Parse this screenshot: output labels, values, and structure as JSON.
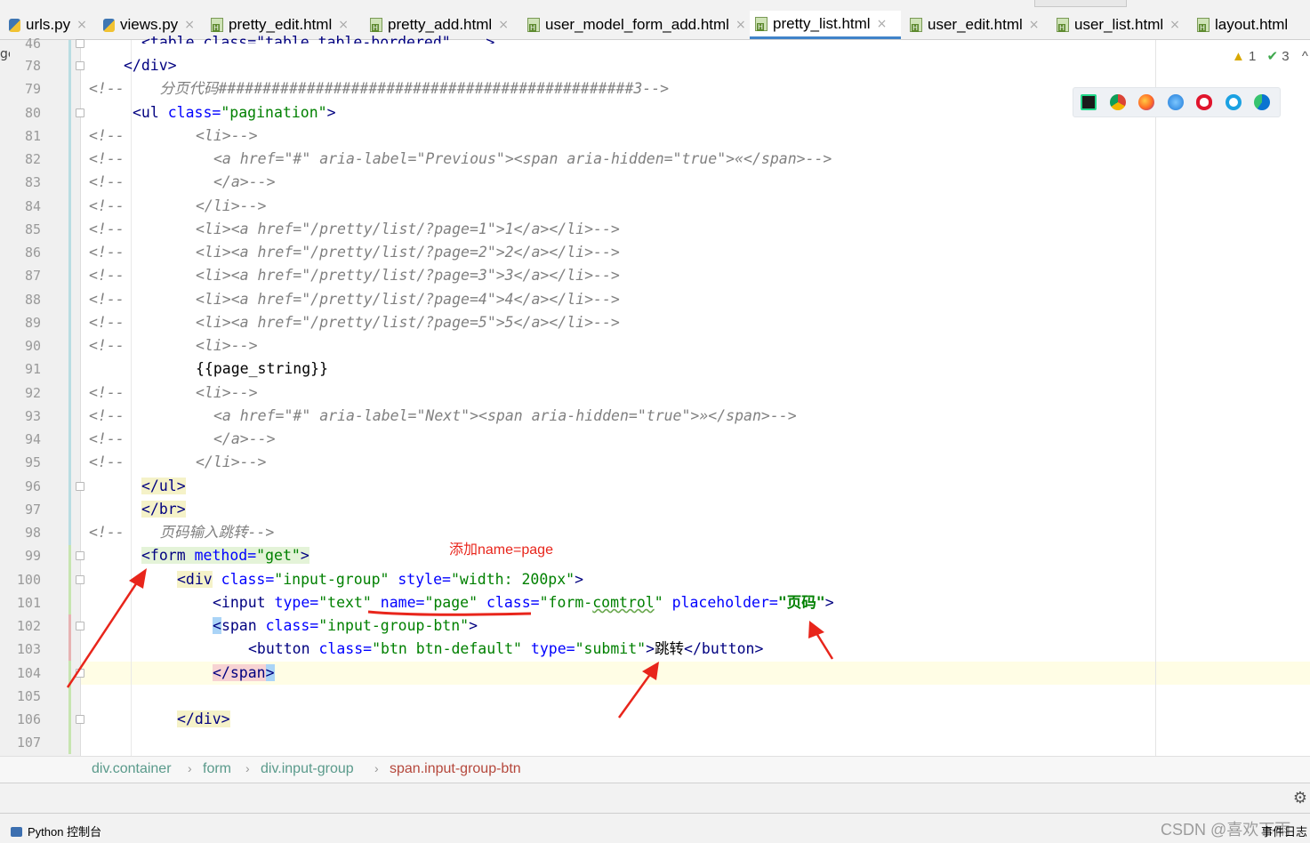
{
  "tabs": [
    {
      "label": "urls.py",
      "type": "py",
      "active": false
    },
    {
      "label": "views.py",
      "type": "py",
      "active": false
    },
    {
      "label": "pretty_edit.html",
      "type": "html",
      "active": false
    },
    {
      "label": "pretty_add.html",
      "type": "html",
      "active": false
    },
    {
      "label": "user_model_form_add.html",
      "type": "html",
      "active": false
    },
    {
      "label": "pretty_list.html",
      "type": "html",
      "active": true
    },
    {
      "label": "user_edit.html",
      "type": "html",
      "active": false
    },
    {
      "label": "user_list.html",
      "type": "html",
      "active": false
    },
    {
      "label": "layout.html",
      "type": "html",
      "active": false
    }
  ],
  "tab_close_glyph": "×",
  "left_fragment": "ge",
  "inspections": {
    "warnings": "1",
    "ok": "3",
    "warn_glyph": "▲",
    "ok_glyph": "✔",
    "collapse_glyph": "^"
  },
  "browsers": [
    "pycharm-icon",
    "chrome-icon",
    "firefox-icon",
    "safari-icon",
    "opera-icon",
    "ie-icon",
    "edge-icon"
  ],
  "gutter": {
    "lines": [
      "46",
      "78",
      "79",
      "80",
      "81",
      "82",
      "83",
      "84",
      "85",
      "86",
      "87",
      "88",
      "89",
      "90",
      "91",
      "92",
      "93",
      "94",
      "95",
      "96",
      "97",
      "98",
      "99",
      "100",
      "101",
      "102",
      "103",
      "104",
      "105",
      "106",
      "107"
    ]
  },
  "code": {
    "l46": "<table class=\"table table-bordered\" ...>",
    "l78_tag": "</div>",
    "l79_cm": "<!--",
    "l79_text": "    分页代码###############################################3-->",
    "l80_open": "<ul",
    "l80_attr": " class=",
    "l80_val": "\"pagination\"",
    "l80_close": ">",
    "c_prefix": "<!--",
    "l81": "<li>-->",
    "l82": "<a href=\"#\" aria-label=\"Previous\"><span aria-hidden=\"true\">«</span>-->",
    "l83": "</a>-->",
    "l84": "</li>-->",
    "l85": "<li><a href=\"/pretty/list/?page=1\">1</a></li>-->",
    "l86": "<li><a href=\"/pretty/list/?page=2\">2</a></li>-->",
    "l87": "<li><a href=\"/pretty/list/?page=3\">3</a></li>-->",
    "l88": "<li><a href=\"/pretty/list/?page=4\">4</a></li>-->",
    "l89": "<li><a href=\"/pretty/list/?page=5\">5</a></li>-->",
    "l90": "<li>-->",
    "l91": "{{page_string}}",
    "l92": "<li>-->",
    "l93": "<a href=\"#\" aria-label=\"Next\"><span aria-hidden=\"true\">»</span>-->",
    "l94": "</a>-->",
    "l95": "</li>-->",
    "l96": "</ul>",
    "l97": "</br>",
    "l98_text": "    页码输入跳转-->",
    "l99_tag": "<form",
    "l99_attr": " method=",
    "l99_val": "\"get\"",
    "l99_close": ">",
    "l100_tag": "<div",
    "l100_attr1": " class=",
    "l100_val1": "\"input-group\"",
    "l100_attr2": " style=",
    "l100_val2": "\"width: 200px\"",
    "l100_close": ">",
    "l101_tag": "<input",
    "l101_a1": " type=",
    "l101_v1": "\"text\"",
    "l101_a2": " name=",
    "l101_v2": "\"page\"",
    "l101_a3": " class=",
    "l101_v3a": "\"form-",
    "l101_v3b": "comtrol",
    "l101_v3c": "\"",
    "l101_a4": " placeholder=",
    "l101_v4": "\"页码\"",
    "l101_close": ">",
    "l102_lt": "<",
    "l102_tag": "span",
    "l102_attr": " class=",
    "l102_val": "\"input-group-btn\"",
    "l102_close": ">",
    "l103_tag": "<button",
    "l103_a1": " class=",
    "l103_v1": "\"btn btn-default\"",
    "l103_a2": " type=",
    "l103_v2": "\"submit\"",
    "l103_gt": ">",
    "l103_text": "跳转",
    "l103_end": "</button>",
    "l104_tag": "</span",
    "l104_gt": ">",
    "l106": "</div>"
  },
  "annotation": "添加name=page",
  "breadcrumb": [
    "div.container",
    "form",
    "div.input-group",
    "span.input-group-btn"
  ],
  "breadcrumb_sep": "›",
  "status": {
    "console": "Python 控制台",
    "watermark": "CSDN @喜欢下雨",
    "events": "事件日志",
    "gear": "⚙"
  },
  "colors": {
    "tag": "#000080",
    "attr": "#0000ff",
    "string": "#008000",
    "comment": "#808080",
    "annotation": "#e8251b",
    "active_tab_underline": "#4083c9"
  }
}
